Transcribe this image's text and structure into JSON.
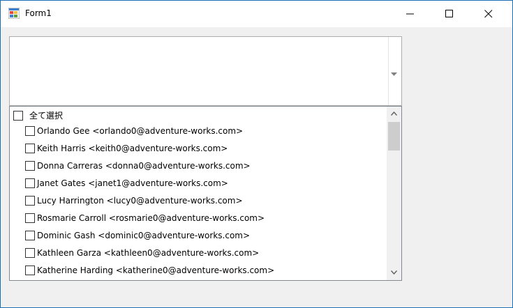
{
  "window": {
    "title": "Form1"
  },
  "combo": {
    "value": ""
  },
  "list": {
    "select_all_label": "全て選択",
    "items": [
      {
        "label": "Orlando Gee <orlando0@adventure-works.com>",
        "checked": false
      },
      {
        "label": "Keith Harris <keith0@adventure-works.com>",
        "checked": false
      },
      {
        "label": "Donna Carreras <donna0@adventure-works.com>",
        "checked": false
      },
      {
        "label": "Janet Gates <janet1@adventure-works.com>",
        "checked": false
      },
      {
        "label": "Lucy Harrington <lucy0@adventure-works.com>",
        "checked": false
      },
      {
        "label": "Rosmarie Carroll <rosmarie0@adventure-works.com>",
        "checked": false
      },
      {
        "label": "Dominic Gash <dominic0@adventure-works.com>",
        "checked": false
      },
      {
        "label": "Kathleen Garza <kathleen0@adventure-works.com>",
        "checked": false
      },
      {
        "label": "Katherine Harding <katherine0@adventure-works.com>",
        "checked": false
      }
    ]
  },
  "icons": {
    "app": "windows-form-icon",
    "minimize": "minimize-icon",
    "maximize": "maximize-icon",
    "close": "close-icon",
    "dropdown": "dropdown-arrow-icon",
    "scroll_up": "scroll-up-icon",
    "scroll_down": "scroll-down-icon"
  },
  "colors": {
    "window_border": "#1c6fb5",
    "titlebar": "#ffffff",
    "client_bg": "#f0f0f0"
  }
}
